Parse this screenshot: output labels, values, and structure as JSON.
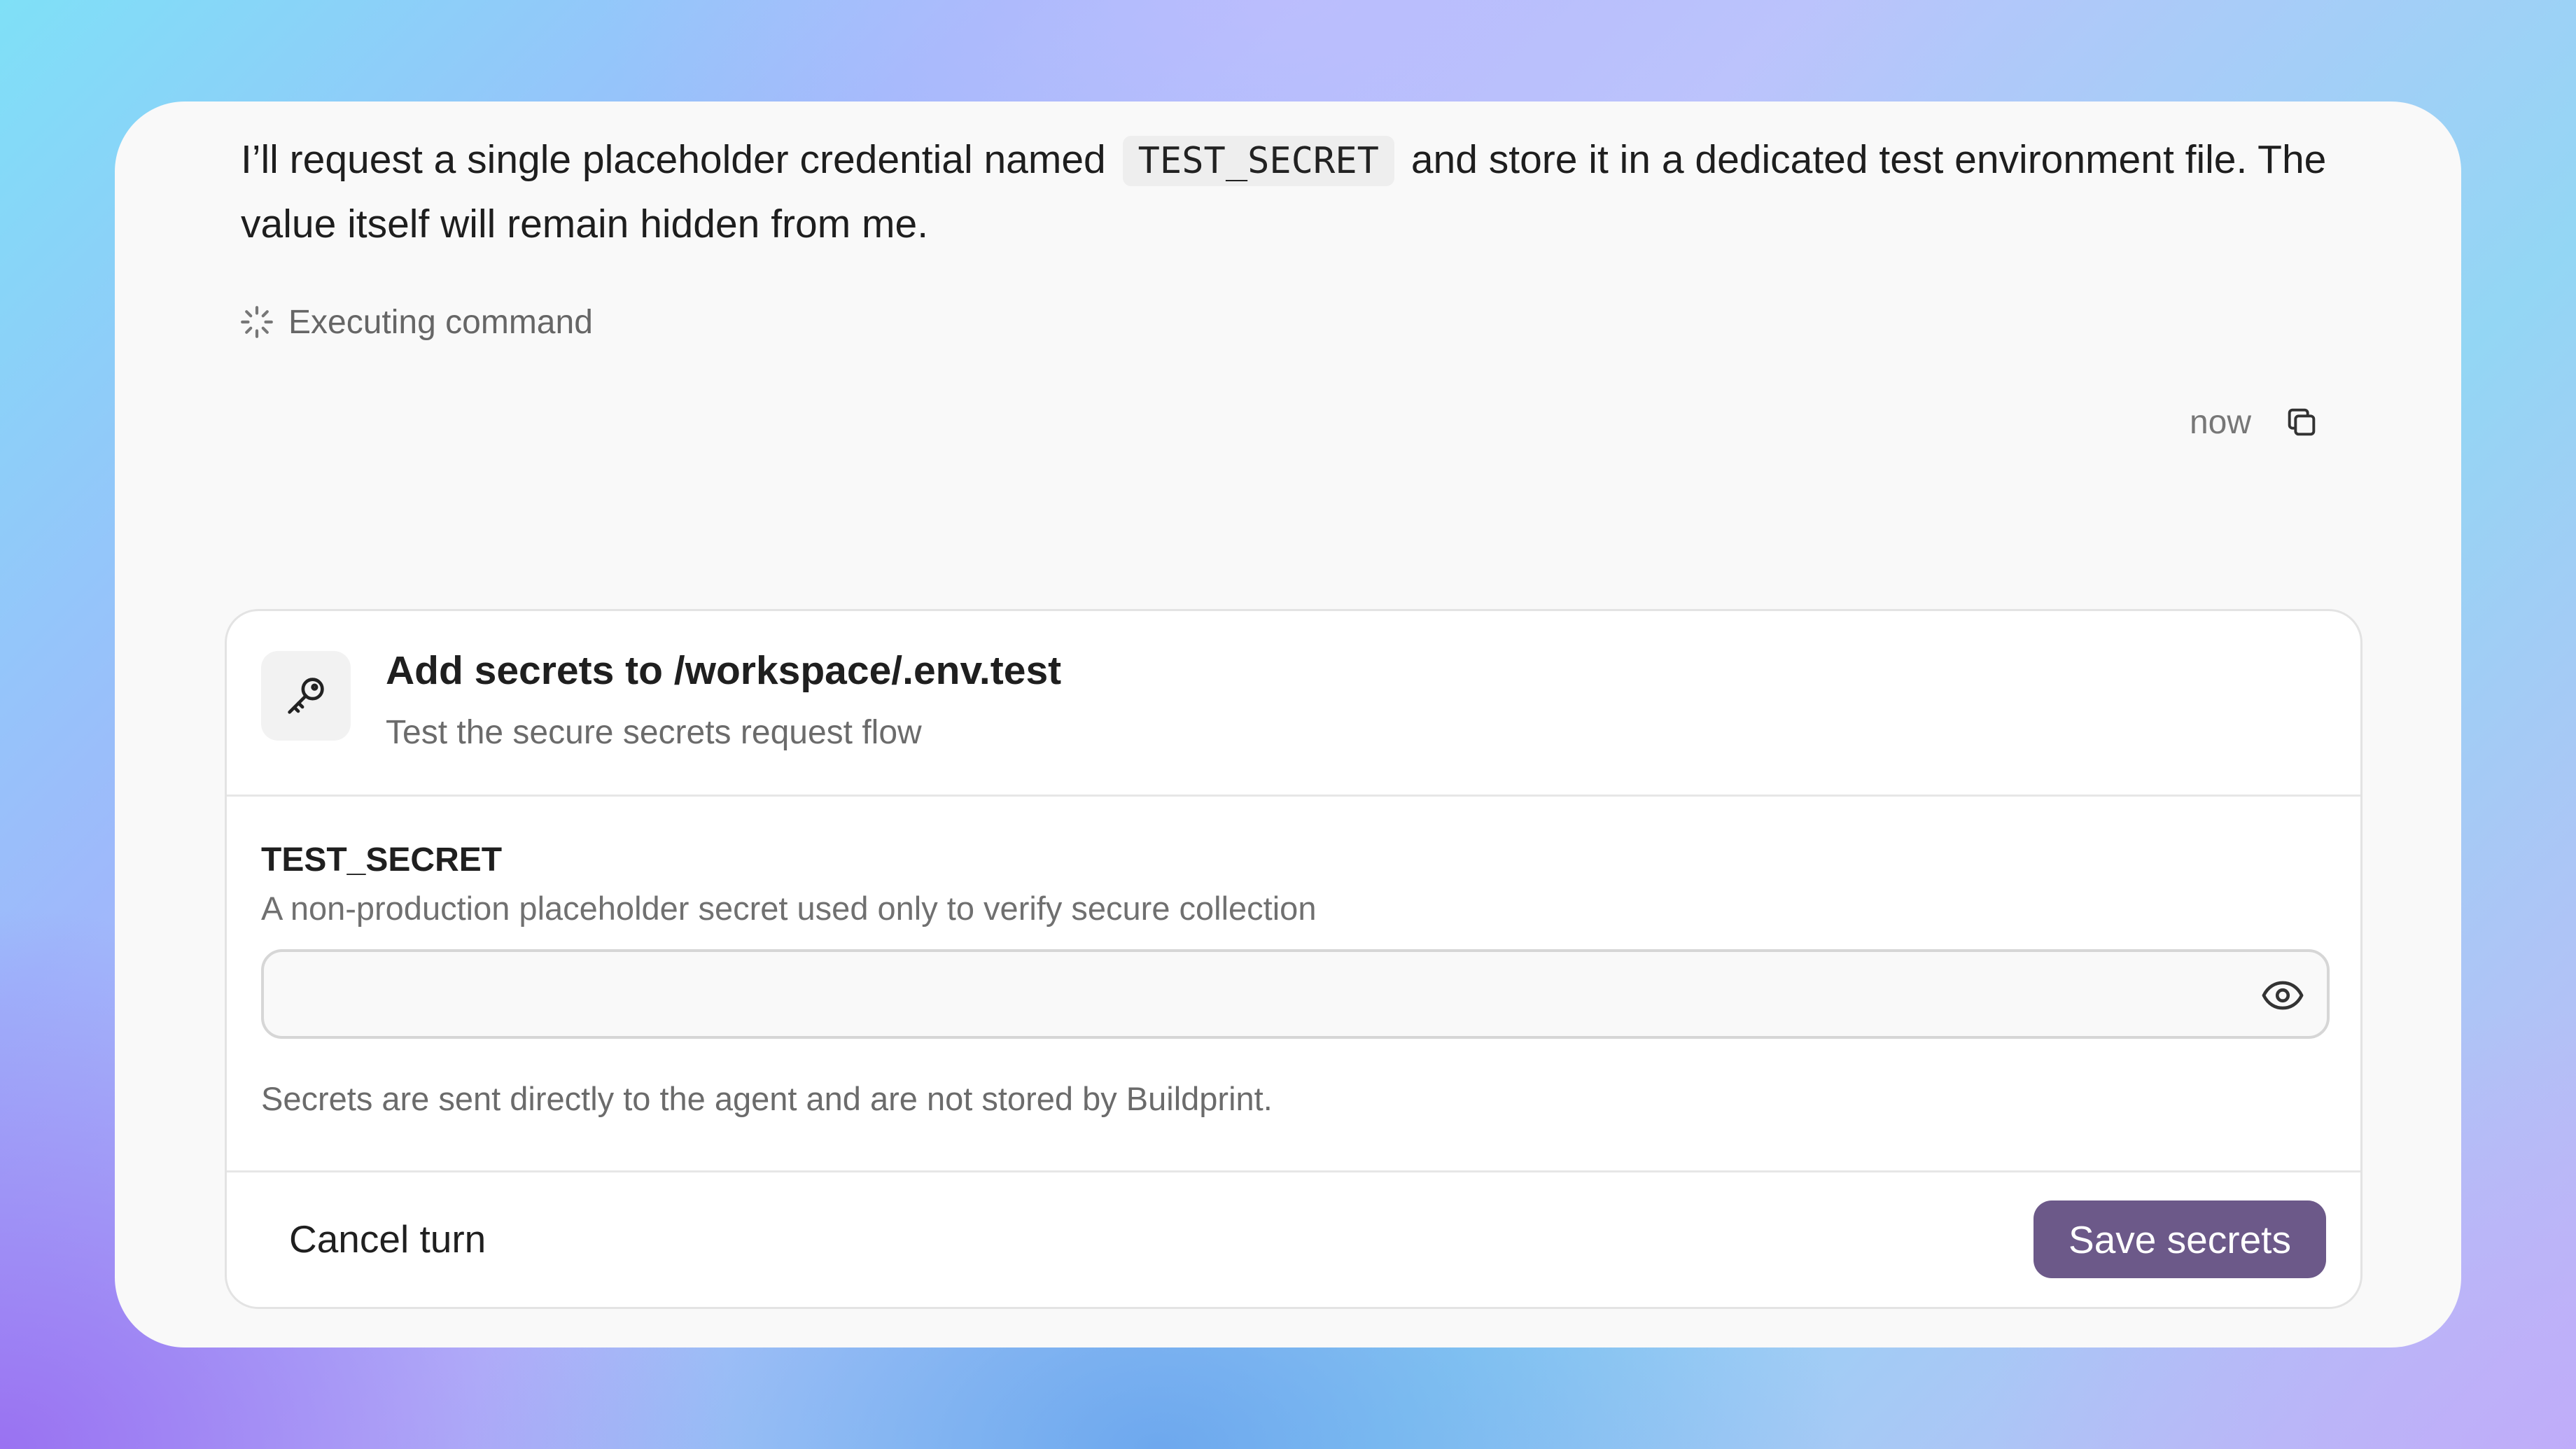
{
  "message": {
    "before_code": "I’ll request a single placeholder credential named",
    "code": "TEST_SECRET",
    "after_code": "and store it in a dedicated test environment file. The value itself will remain hidden from me."
  },
  "status": {
    "icon": "spinner-icon",
    "text": "Executing command"
  },
  "meta": {
    "timestamp": "now",
    "copy_icon": "copy-icon"
  },
  "secrets_request": {
    "icon": "key-icon",
    "title": "Add secrets to /workspace/.env.test",
    "subtitle": "Test the secure secrets request flow",
    "field": {
      "name": "TEST_SECRET",
      "description": "A non-production placeholder secret used only to verify secure collection",
      "value": "",
      "toggle_icon": "eye-icon"
    },
    "notice": "Secrets are sent directly to the agent and are not stored by Buildprint.",
    "cancel_label": "Cancel turn",
    "save_label": "Save secrets",
    "accent_color": "#6c5989"
  }
}
